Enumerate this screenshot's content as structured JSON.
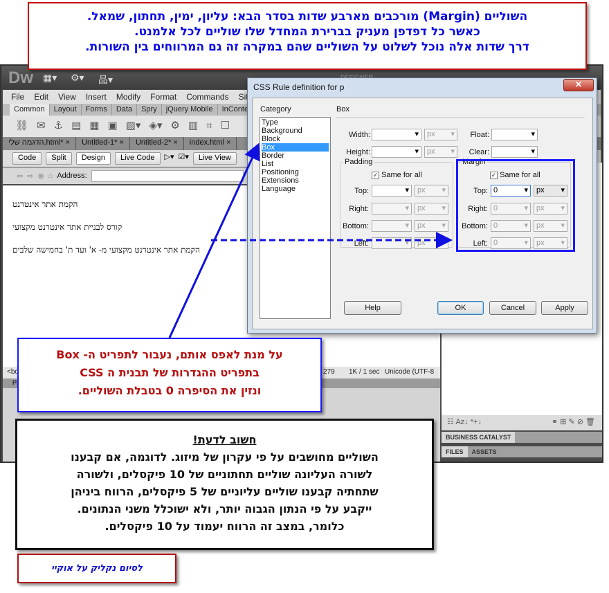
{
  "app": {
    "logo": "Dw",
    "title_icons": [
      "layout-icon",
      "gear-icon",
      "site-icon"
    ],
    "workspace": "DESIGNER"
  },
  "menu": [
    "File",
    "Edit",
    "View",
    "Insert",
    "Modify",
    "Format",
    "Commands",
    "Site"
  ],
  "insert_tabs": [
    "Common",
    "Layout",
    "Forms",
    "Data",
    "Spry",
    "jQuery Mobile",
    "InContext Ed"
  ],
  "doc_tabs": [
    "הדגמה שלי.html*",
    "Untitled-1*",
    "Untitled-2*",
    "index.html"
  ],
  "doc_toolbar": {
    "code": "Code",
    "split": "Split",
    "design": "Design",
    "live_code": "Live Code",
    "live_view": "Live View"
  },
  "address_label": "Address:",
  "content_lines": [
    "הקמת אתר אינטרנט",
    "קורס לבניית אתר אינטרנט מקצועי",
    "הקמת אתר אינטרנט מקצועי מ- א' ועד ת' בחמישה שלבים"
  ],
  "status": {
    "tag": "<bo",
    "size": "279",
    "download": "1K / 1 sec",
    "encoding": "Unicode (UTF-8"
  },
  "props_head": "PR",
  "panels": {
    "business_catalyst": "BUSINESS CATALYST",
    "files": "FILES",
    "assets": "ASSETS"
  },
  "dialog": {
    "title": "CSS Rule definition for p",
    "category_label": "Category",
    "categories": [
      "Type",
      "Background",
      "Block",
      "Box",
      "Border",
      "List",
      "Positioning",
      "Extensions",
      "Language"
    ],
    "selected_category": "Box",
    "section": "Box",
    "width_label": "Width:",
    "height_label": "Height:",
    "float_label": "Float:",
    "clear_label": "Clear:",
    "unit": "px",
    "padding": {
      "legend": "Padding",
      "same": "Same for all",
      "top": "Top:",
      "right": "Right:",
      "bottom": "Bottom:",
      "left": "Left:"
    },
    "margin": {
      "legend": "Margin",
      "same": "Same for all",
      "top": "Top:",
      "right": "Right:",
      "bottom": "Bottom:",
      "left": "Left:",
      "top_value": "0",
      "right_value": "0",
      "bottom_value": "0",
      "left_value": "0"
    },
    "help": "Help",
    "ok": "OK",
    "cancel": "Cancel",
    "apply": "Apply"
  },
  "callouts": {
    "top": [
      "השוליים (Margin) מורכבים מארבע שדות בסדר הבא: עליון, ימין, תחתון, שמאל.",
      "כאשר כל דפדפן מעניק בברירת המחדל שלו שוליים לכל אלמנט.",
      "דרך שדות אלה נוכל לשלוט על השוליים שהם במקרה זה גם המרווחים בין השורות."
    ],
    "middle": [
      "על מנת לאפס אותם, נעבור לתפריט ה- Box",
      "בתפריט ההגדרות של תבנית ה CSS",
      "ונזין את הסיפרה 0 בטבלת השוליים."
    ],
    "important_title": "חשוב לדעת!",
    "important": [
      "השוליים מחושבים על פי עקרון של מיזוג. לדוגמה, אם קבענו",
      "לשורה העליונה שוליים תחתוניים של 10 פיקסלים, ולשורה",
      "שתחתיה קבענו שוליים עליוניים של 5 פיקסלים, הרווח ביניהן",
      "ייקבע על פי הנתון הגבוה יותר, ולא ישוכלל משני הנתונים.",
      "כלומר, במצב זה הרווח יעמוד על 10 פיקסלים."
    ],
    "finish": "לסיום נקליק על אוקיי"
  },
  "colors": {
    "callout_red": "#c01010",
    "callout_blue": "#1a1aff",
    "arrow": "#1010e0"
  }
}
